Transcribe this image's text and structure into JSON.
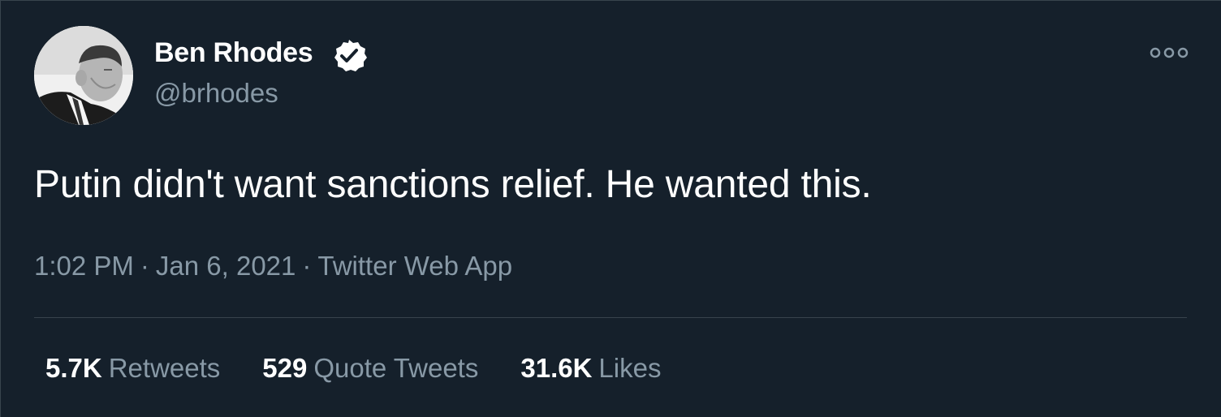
{
  "author": {
    "display_name": "Ben Rhodes",
    "handle": "@brhodes",
    "verified": true
  },
  "tweet": {
    "text": "Putin didn't want sanctions relief. He wanted this.",
    "time": "1:02 PM",
    "separator": "·",
    "date": "Jan 6, 2021",
    "source": "Twitter Web App"
  },
  "stats": {
    "retweets_count": "5.7K",
    "retweets_label": "Retweets",
    "quotes_count": "529",
    "quotes_label": "Quote Tweets",
    "likes_count": "31.6K",
    "likes_label": "Likes"
  },
  "colors": {
    "background": "#15202b",
    "primary_text": "#ffffff",
    "secondary_text": "#8899a6",
    "divider": "#38444d"
  },
  "icons": {
    "verified": "verified-badge-icon",
    "more": "more-options-icon"
  }
}
